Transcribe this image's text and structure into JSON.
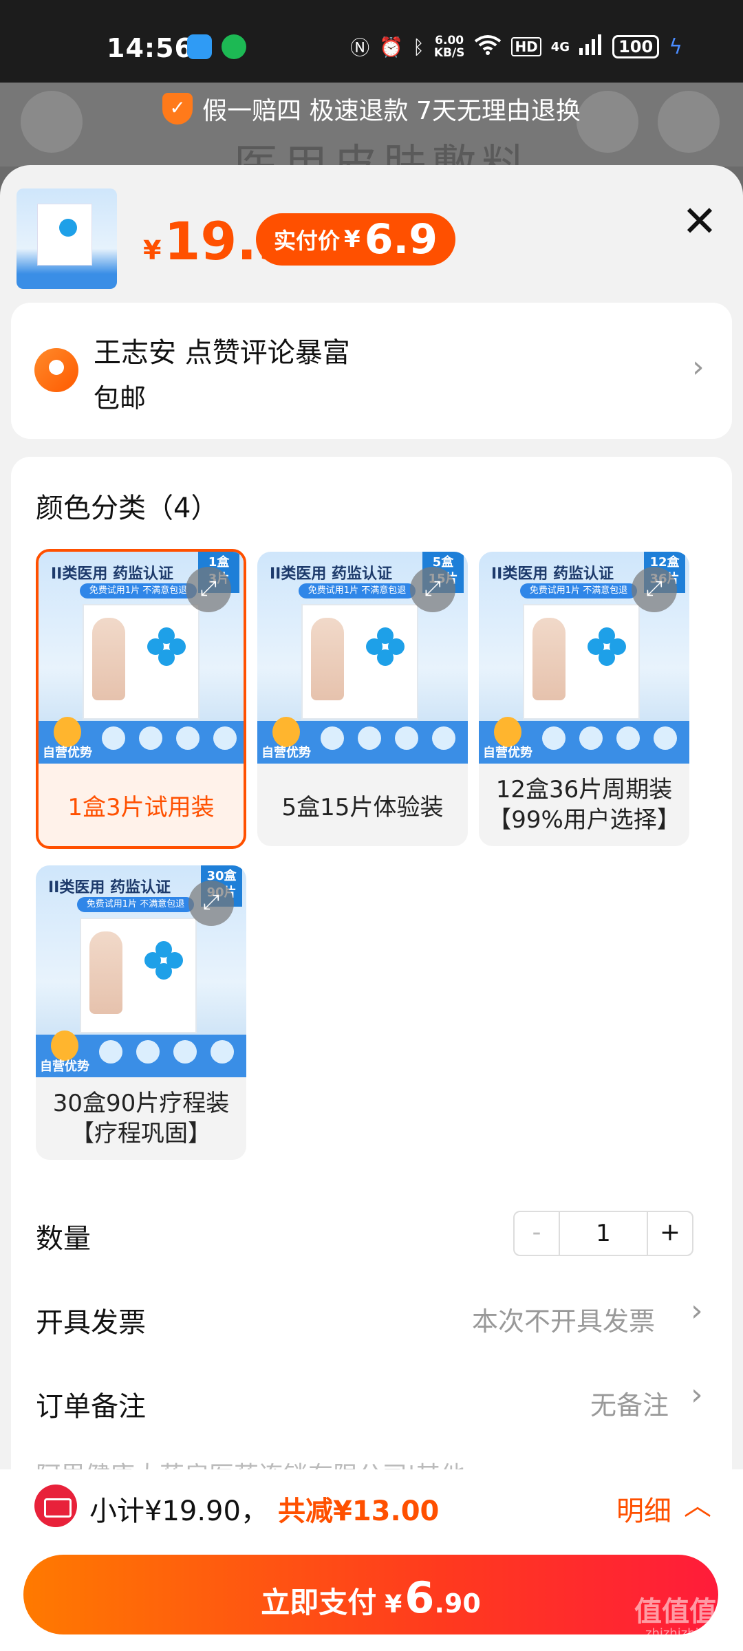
{
  "status_bar": {
    "time": "14:56",
    "net_speed_value": "6.00",
    "net_speed_unit": "KB/S",
    "hd": "HD",
    "network": "4G",
    "battery": "100"
  },
  "background_page": {
    "promo_text": "假一赔四 极速退款 7天无理由退换",
    "title_partial": "医用皮肤敷料"
  },
  "sheet": {
    "price_symbol": "¥",
    "price": "19.9",
    "real_price_label": "实付价",
    "real_price_symbol": "¥",
    "real_price": "6.9",
    "close_label": "✕"
  },
  "address": {
    "name": "王志安 点赞评论暴富",
    "shipping": "包邮"
  },
  "sku_section": {
    "title": "颜色分类（4）",
    "image_text": {
      "header": "II类医用 药监认证",
      "sub": "免费试用1片  不满意包退",
      "self_run": "自营优势"
    },
    "options": [
      {
        "label": "1盒3片试用装",
        "badge": "1盒\n3片",
        "selected": true
      },
      {
        "label": "5盒15片体验装",
        "badge": "5盒\n15片",
        "selected": false
      },
      {
        "label": "12盒36片周期装\n【99%用户选择】",
        "badge": "12盒\n36片",
        "selected": false
      },
      {
        "label": "30盒90片疗程装\n【疗程巩固】",
        "badge": "30盒\n90片",
        "selected": false
      }
    ]
  },
  "quantity": {
    "label": "数量",
    "minus": "-",
    "value": "1",
    "plus": "+"
  },
  "invoice": {
    "label": "开具发票",
    "value": "本次不开具发票"
  },
  "remark": {
    "label": "订单备注",
    "value": "无备注"
  },
  "cutoff_text": "阿里健康大药房医药连锁有限公司|其他",
  "bottom_bar": {
    "subtotal": "小计¥19.90，",
    "discount": "共减¥13.00",
    "detail": "明细",
    "pay_label": "立即支付",
    "pay_symbol": "¥",
    "pay_big": "6",
    "pay_small": ".90"
  },
  "watermark": {
    "text": "值值值",
    "domain": "zhizhizhi.com"
  },
  "colors": {
    "accent": "#ff5000",
    "pay_gradient_start": "#ff7a00",
    "pay_gradient_end": "#ff1c3a"
  }
}
